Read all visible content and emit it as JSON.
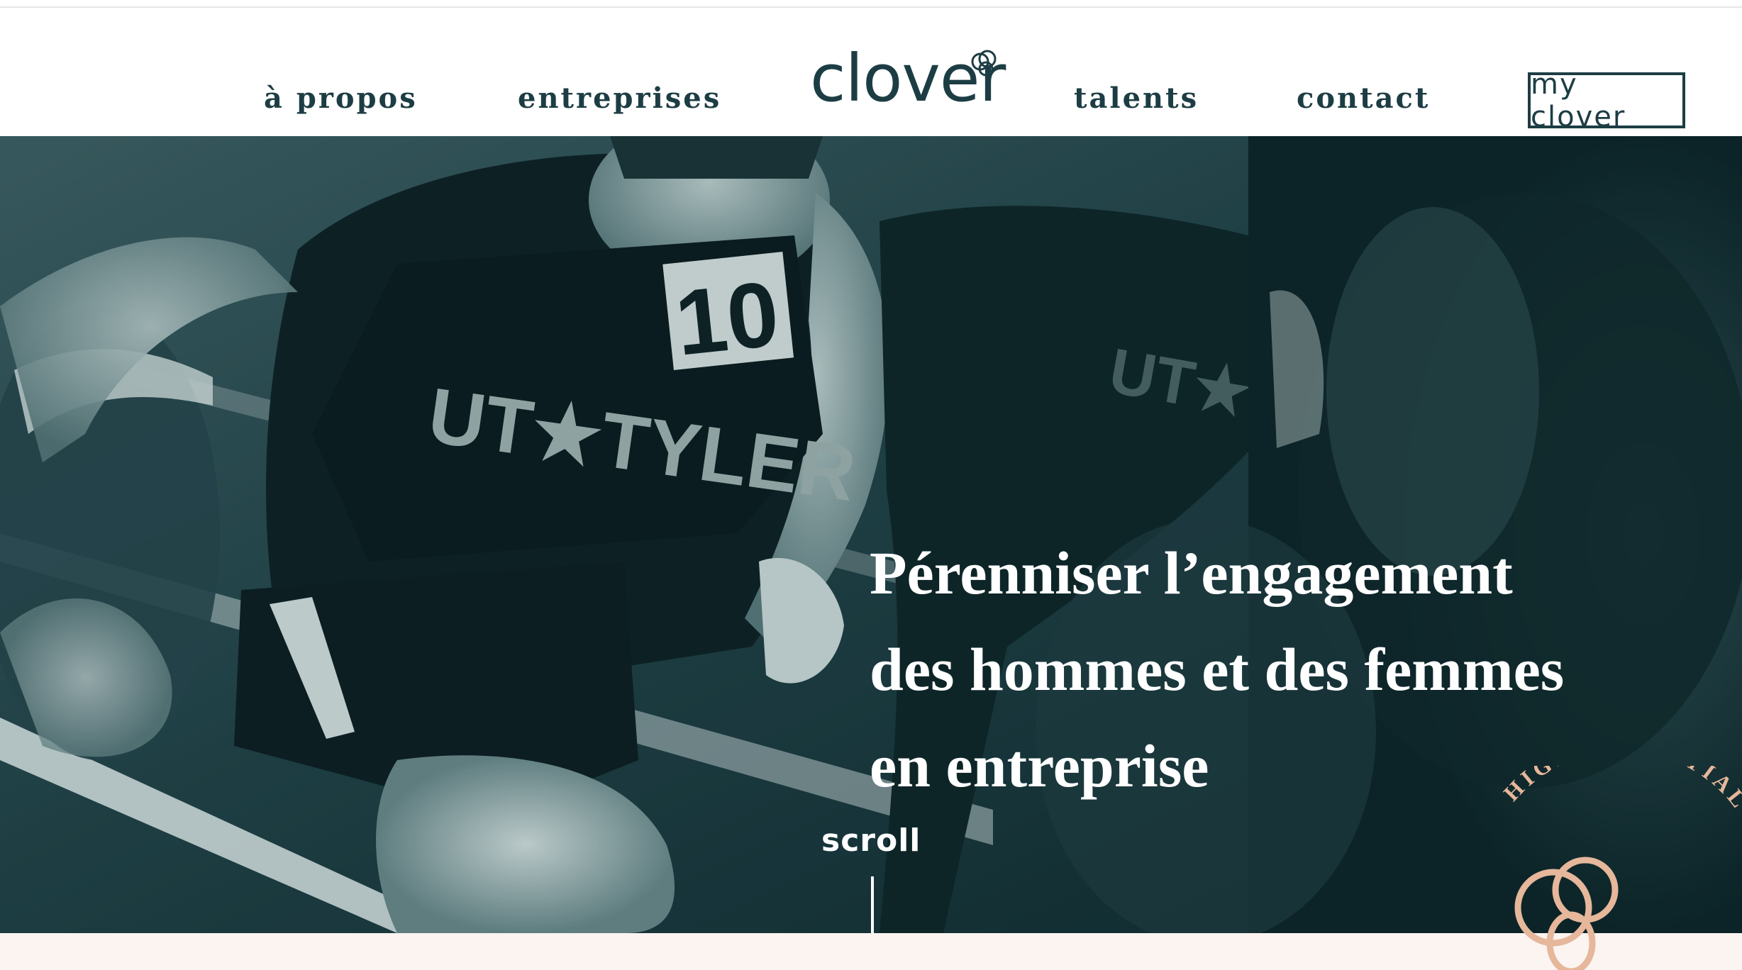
{
  "nav": {
    "left_items": [
      {
        "label": "à propos"
      },
      {
        "label": "entreprises"
      }
    ],
    "logo_text": "clover",
    "right_items": [
      {
        "label": "talents"
      },
      {
        "label": "contact"
      }
    ],
    "account_button": "my clover"
  },
  "hero": {
    "headline_lines": [
      "Pérenniser l’engagement",
      "des hommes et des femmes",
      "en entreprise"
    ],
    "scroll_label": "scroll",
    "photo_jersey_text": "UT★TYLER",
    "photo_bib_number": "10",
    "badge_text": "HIGH POTENTIAL AG"
  },
  "colors": {
    "brand_dark": "#1d3d44",
    "accent_peach": "#e6b79a",
    "hero_tint": "#173c42",
    "footer_bg": "#fbf4f1"
  }
}
